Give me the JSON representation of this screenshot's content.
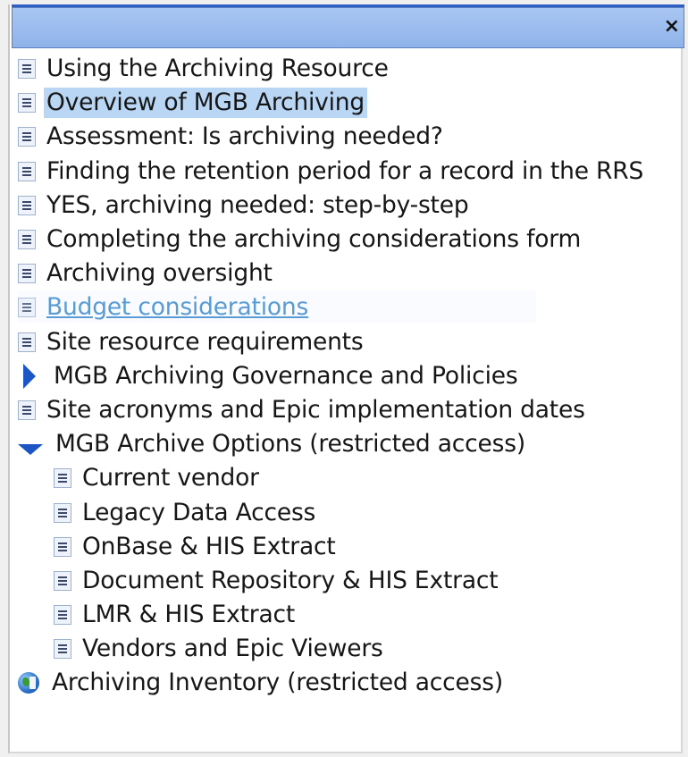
{
  "window": {
    "close_label": "×"
  },
  "tree": {
    "items": [
      {
        "label": "Using the Archiving Resource"
      },
      {
        "label": "Overview of MGB Archiving"
      },
      {
        "label": "Assessment: Is archiving needed?"
      },
      {
        "label": "Finding the retention period for a record in the RRS"
      },
      {
        "label": "YES, archiving needed: step-by-step"
      },
      {
        "label": "Completing the archiving considerations form"
      },
      {
        "label": "Archiving oversight"
      },
      {
        "label": "Budget considerations"
      },
      {
        "label": "Site resource requirements"
      },
      {
        "label": "MGB Archiving Governance and Policies"
      },
      {
        "label": "Site acronyms and Epic implementation dates"
      },
      {
        "label": "MGB Archive Options (restricted access)"
      },
      {
        "label": "Current vendor"
      },
      {
        "label": "Legacy Data Access"
      },
      {
        "label": "OnBase & HIS Extract"
      },
      {
        "label": "Document Repository & HIS Extract"
      },
      {
        "label": "LMR & HIS Extract"
      },
      {
        "label": "Vendors and Epic Viewers"
      },
      {
        "label": "Archiving Inventory (restricted access)"
      }
    ]
  },
  "colors": {
    "titlebar": "#9dbdee",
    "selection": "#b9d7f5",
    "link": "#2a7fc9",
    "expander": "#1b56c4"
  }
}
